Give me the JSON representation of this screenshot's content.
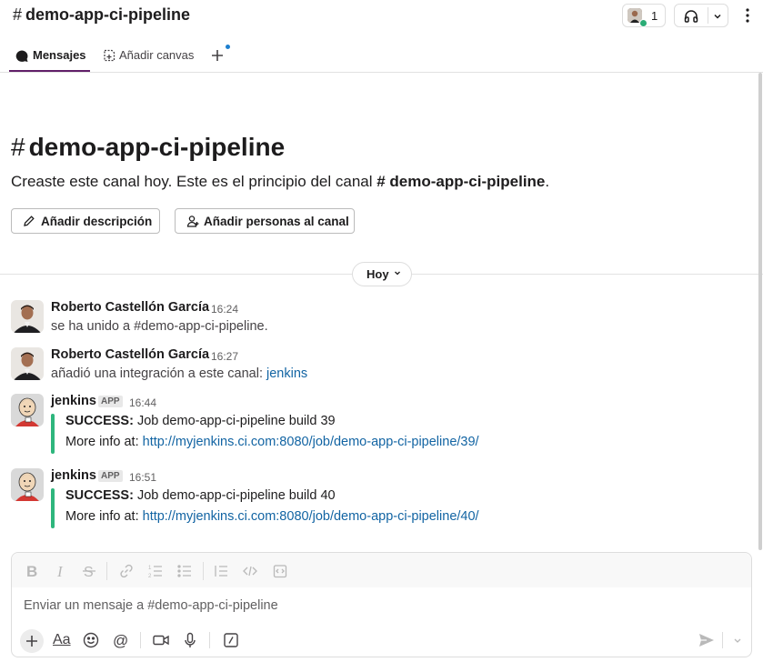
{
  "header": {
    "channel_hash": "#",
    "channel_name": "demo-app-ci-pipeline",
    "member_count": "1"
  },
  "tabs": [
    {
      "label": "Mensajes"
    },
    {
      "label": "Añadir canvas"
    }
  ],
  "intro": {
    "hash": "#",
    "title": "demo-app-ci-pipeline",
    "text_before": "Creaste este canal hoy. Este es el principio del canal ",
    "text_channel": "# demo-app-ci-pipeline",
    "text_after": ".",
    "add_description": "Añadir descripción",
    "add_people": "Añadir personas al canal"
  },
  "divider": {
    "label": "Hoy"
  },
  "messages": [
    {
      "author": "Roberto Castellón García",
      "time": "16:24",
      "text": "se ha unido a #demo-app-ci-pipeline."
    },
    {
      "author": "Roberto Castellón García",
      "time": "16:27",
      "text": "añadió una integración a este canal: ",
      "link": "jenkins"
    },
    {
      "author": "jenkins",
      "badge": "APP",
      "time": "16:44",
      "status": "SUCCESS:",
      "job": " Job demo-app-ci-pipeline build 39",
      "more": "More info at: ",
      "url": "http://myjenkins.ci.com:8080/job/demo-app-ci-pipeline/39/"
    },
    {
      "author": "jenkins",
      "badge": "APP",
      "time": "16:51",
      "status": "SUCCESS:",
      "job": " Job demo-app-ci-pipeline build 40",
      "more": "More info at: ",
      "url": "http://myjenkins.ci.com:8080/job/demo-app-ci-pipeline/40/"
    }
  ],
  "composer": {
    "placeholder": "Enviar un mensaje a #demo-app-ci-pipeline",
    "aa_label": "Aa"
  },
  "colors": {
    "accent_tab": "#611f69",
    "link": "#1264a3",
    "attachment_bar": "#2eb67d",
    "online": "#2bac76"
  }
}
